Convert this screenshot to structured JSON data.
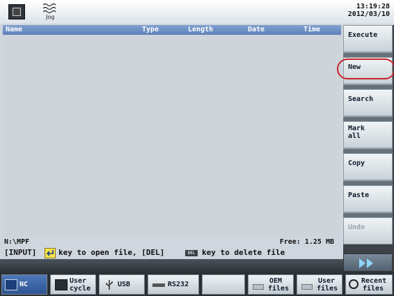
{
  "header": {
    "mode_label": "Jog",
    "time": "13:19:28",
    "date": "2012/03/10"
  },
  "file_list": {
    "columns": [
      "Name",
      "Type",
      "Length",
      "Date",
      "Time"
    ]
  },
  "status": {
    "path": "N:\\MPF",
    "free": "Free: 1.25 MB",
    "hint_part1": "[INPUT]",
    "hint_part2": "key to open file, [DEL]",
    "hint_del_key": "DEL",
    "hint_part3": "key to delete file"
  },
  "vertical_softkeys": [
    {
      "label": "Execute"
    },
    {
      "label": "New"
    },
    {
      "label": "Search"
    },
    {
      "label": "Mark\nall"
    },
    {
      "label": "Copy"
    },
    {
      "label": "Paste"
    },
    {
      "label": "Undo"
    }
  ],
  "horizontal_softkeys": {
    "nc": "NC",
    "user_cycle_1": "User",
    "user_cycle_2": "cycle",
    "usb": "USB",
    "rs232": "RS232",
    "oem_1": "OEM",
    "oem_2": "files",
    "user_files_1": "User",
    "user_files_2": "files",
    "recent_1": "Recent",
    "recent_2": "files"
  },
  "icons": {
    "machine": "machine-icon",
    "jog": "jog-wave-icon",
    "enter": "enter-key-icon",
    "forward": "double-arrow-right-icon"
  },
  "colors": {
    "header_bar": "#5f82b8",
    "active_tab": "#2e5493",
    "highlight_circle": "#c8242c"
  }
}
